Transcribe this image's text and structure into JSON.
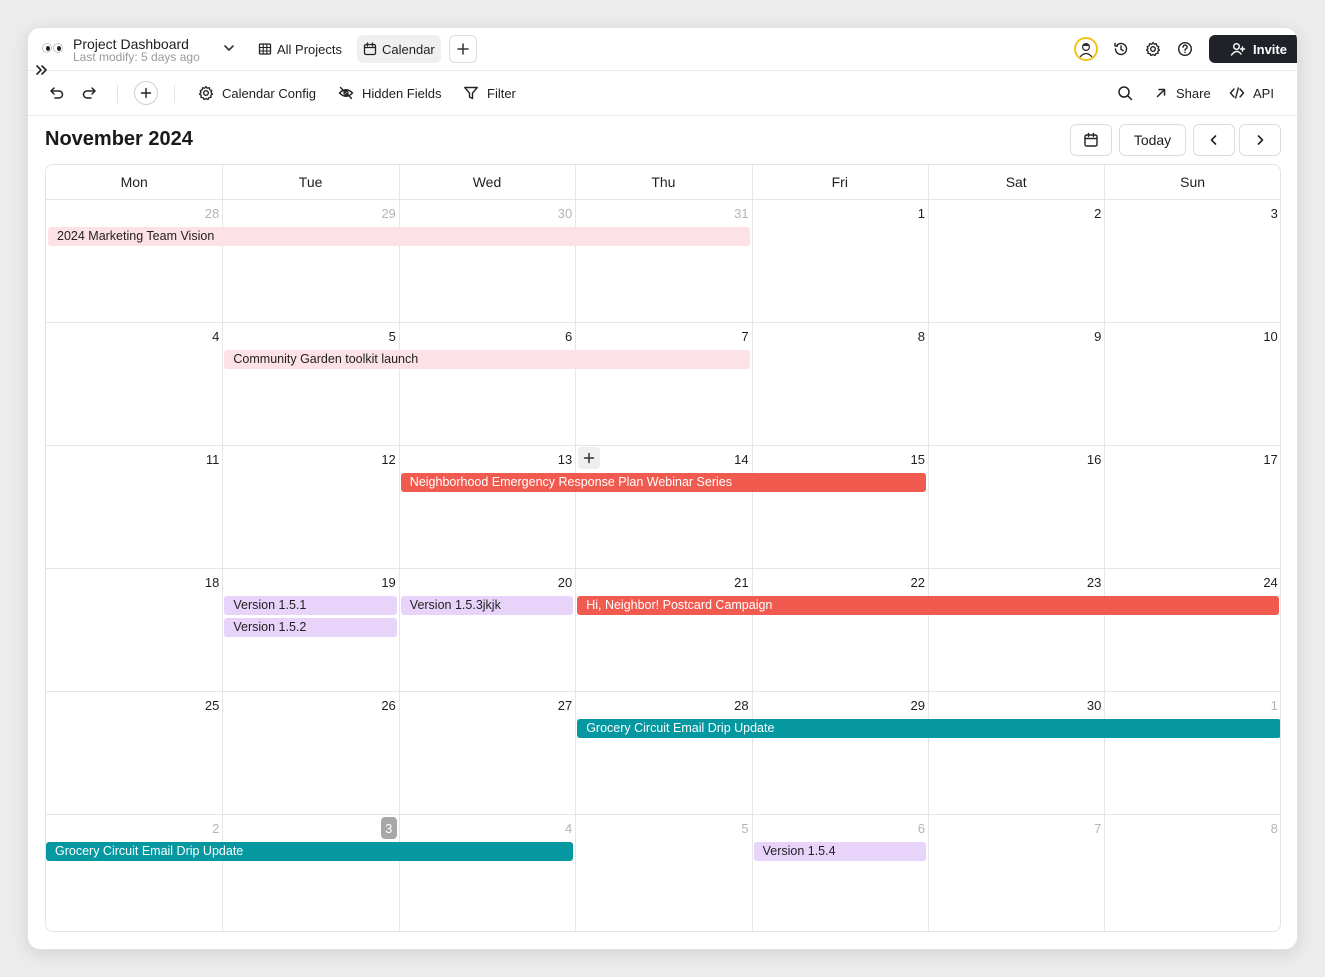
{
  "app": {
    "title": "Project Dashboard",
    "subtitle": "Last modify: 5 days ago"
  },
  "views": [
    {
      "label": "All Projects",
      "icon": "table-icon",
      "active": false
    },
    {
      "label": "Calendar",
      "icon": "calendar-icon",
      "active": true
    }
  ],
  "topbar": {
    "invite_label": "Invite"
  },
  "toolbar": {
    "calendar_config": "Calendar Config",
    "hidden_fields": "Hidden Fields",
    "filter": "Filter",
    "share": "Share",
    "api": "API"
  },
  "calendar": {
    "month_title": "November 2024",
    "today_label": "Today",
    "weekdays": [
      "Mon",
      "Tue",
      "Wed",
      "Thu",
      "Fri",
      "Sat",
      "Sun"
    ],
    "weeks": [
      [
        {
          "n": "28",
          "m": true
        },
        {
          "n": "29",
          "m": true
        },
        {
          "n": "30",
          "m": true
        },
        {
          "n": "31",
          "m": true
        },
        {
          "n": "1"
        },
        {
          "n": "2"
        },
        {
          "n": "3"
        }
      ],
      [
        {
          "n": "4"
        },
        {
          "n": "5"
        },
        {
          "n": "6"
        },
        {
          "n": "7"
        },
        {
          "n": "8"
        },
        {
          "n": "9"
        },
        {
          "n": "10"
        }
      ],
      [
        {
          "n": "11"
        },
        {
          "n": "12"
        },
        {
          "n": "13"
        },
        {
          "n": "14"
        },
        {
          "n": "15"
        },
        {
          "n": "16"
        },
        {
          "n": "17"
        }
      ],
      [
        {
          "n": "18"
        },
        {
          "n": "19"
        },
        {
          "n": "20"
        },
        {
          "n": "21"
        },
        {
          "n": "22"
        },
        {
          "n": "23"
        },
        {
          "n": "24"
        }
      ],
      [
        {
          "n": "25"
        },
        {
          "n": "26"
        },
        {
          "n": "27"
        },
        {
          "n": "28"
        },
        {
          "n": "29"
        },
        {
          "n": "30"
        },
        {
          "n": "1",
          "m": true
        }
      ],
      [
        {
          "n": "2",
          "m": true
        },
        {
          "n": "3",
          "m": true,
          "today": true
        },
        {
          "n": "4",
          "m": true
        },
        {
          "n": "5",
          "m": true
        },
        {
          "n": "6",
          "m": true
        },
        {
          "n": "7",
          "m": true
        },
        {
          "n": "8",
          "m": true
        }
      ]
    ],
    "events": [
      {
        "title": "2024 Marketing Team Vision",
        "color": "pink",
        "week": 0,
        "start": 0,
        "span": 4,
        "lane": 0
      },
      {
        "title": "Community Garden toolkit launch",
        "color": "pink",
        "week": 1,
        "start": 1,
        "span": 3,
        "lane": 0
      },
      {
        "title": "Neighborhood Emergency Response Plan Webinar Series",
        "color": "red",
        "week": 2,
        "start": 2,
        "span": 3,
        "lane": 0
      },
      {
        "title": "Version 1.5.1",
        "color": "purple",
        "week": 3,
        "start": 1,
        "span": 1,
        "lane": 0
      },
      {
        "title": "Version 1.5.2",
        "color": "purple",
        "week": 3,
        "start": 1,
        "span": 1,
        "lane": 1
      },
      {
        "title": "Version 1.5.3jkjk",
        "color": "purple",
        "week": 3,
        "start": 2,
        "span": 1,
        "lane": 0
      },
      {
        "title": "Hi, Neighbor! Postcard Campaign",
        "color": "red",
        "week": 3,
        "start": 3,
        "span": 4,
        "lane": 0
      },
      {
        "title": "Grocery Circuit Email Drip Update",
        "color": "teal",
        "week": 4,
        "start": 3,
        "span": 4,
        "lane": 0
      },
      {
        "title": "Grocery Circuit Email Drip Update",
        "color": "teal",
        "week": 5,
        "start": 0,
        "span": 3,
        "lane": 0
      },
      {
        "title": "Version 1.5.4",
        "color": "purple",
        "week": 5,
        "start": 4,
        "span": 1,
        "lane": 0
      }
    ],
    "add_cell": {
      "week": 2,
      "day": 3
    }
  },
  "colors": {
    "pink": "#fce1e6",
    "red": "#f05a4f",
    "teal": "#0598a0",
    "purple": "#e8d4fb",
    "invite_bg": "#1f2329"
  }
}
